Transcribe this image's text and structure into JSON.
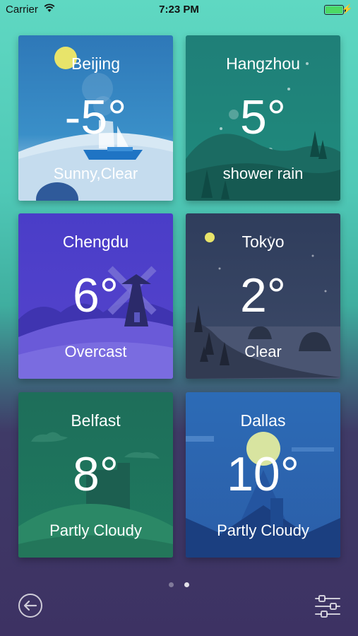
{
  "status_bar": {
    "carrier": "Carrier",
    "time": "7:23 PM",
    "charging_symbol": "⚡"
  },
  "cities": [
    {
      "city": "Beijing",
      "temp": "-5°",
      "condition": "Sunny,Clear"
    },
    {
      "city": "Hangzhou",
      "temp": "5°",
      "condition": "shower rain"
    },
    {
      "city": "Chengdu",
      "temp": "6°",
      "condition": "Overcast"
    },
    {
      "city": "Tokyo",
      "temp": "2°",
      "condition": "Clear"
    },
    {
      "city": "Belfast",
      "temp": "8°",
      "condition": "Partly Cloudy"
    },
    {
      "city": "Dallas",
      "temp": "10°",
      "condition": "Partly Cloudy"
    }
  ],
  "pager": {
    "page_count": 2,
    "active_page": 2
  },
  "icons": {
    "back": "back-circle-arrow-icon",
    "settings": "sliders-settings-icon",
    "wifi": "wifi-icon",
    "battery": "battery-icon"
  },
  "colors": {
    "battery_fill": "#4cd964",
    "text": "#ffffff"
  }
}
